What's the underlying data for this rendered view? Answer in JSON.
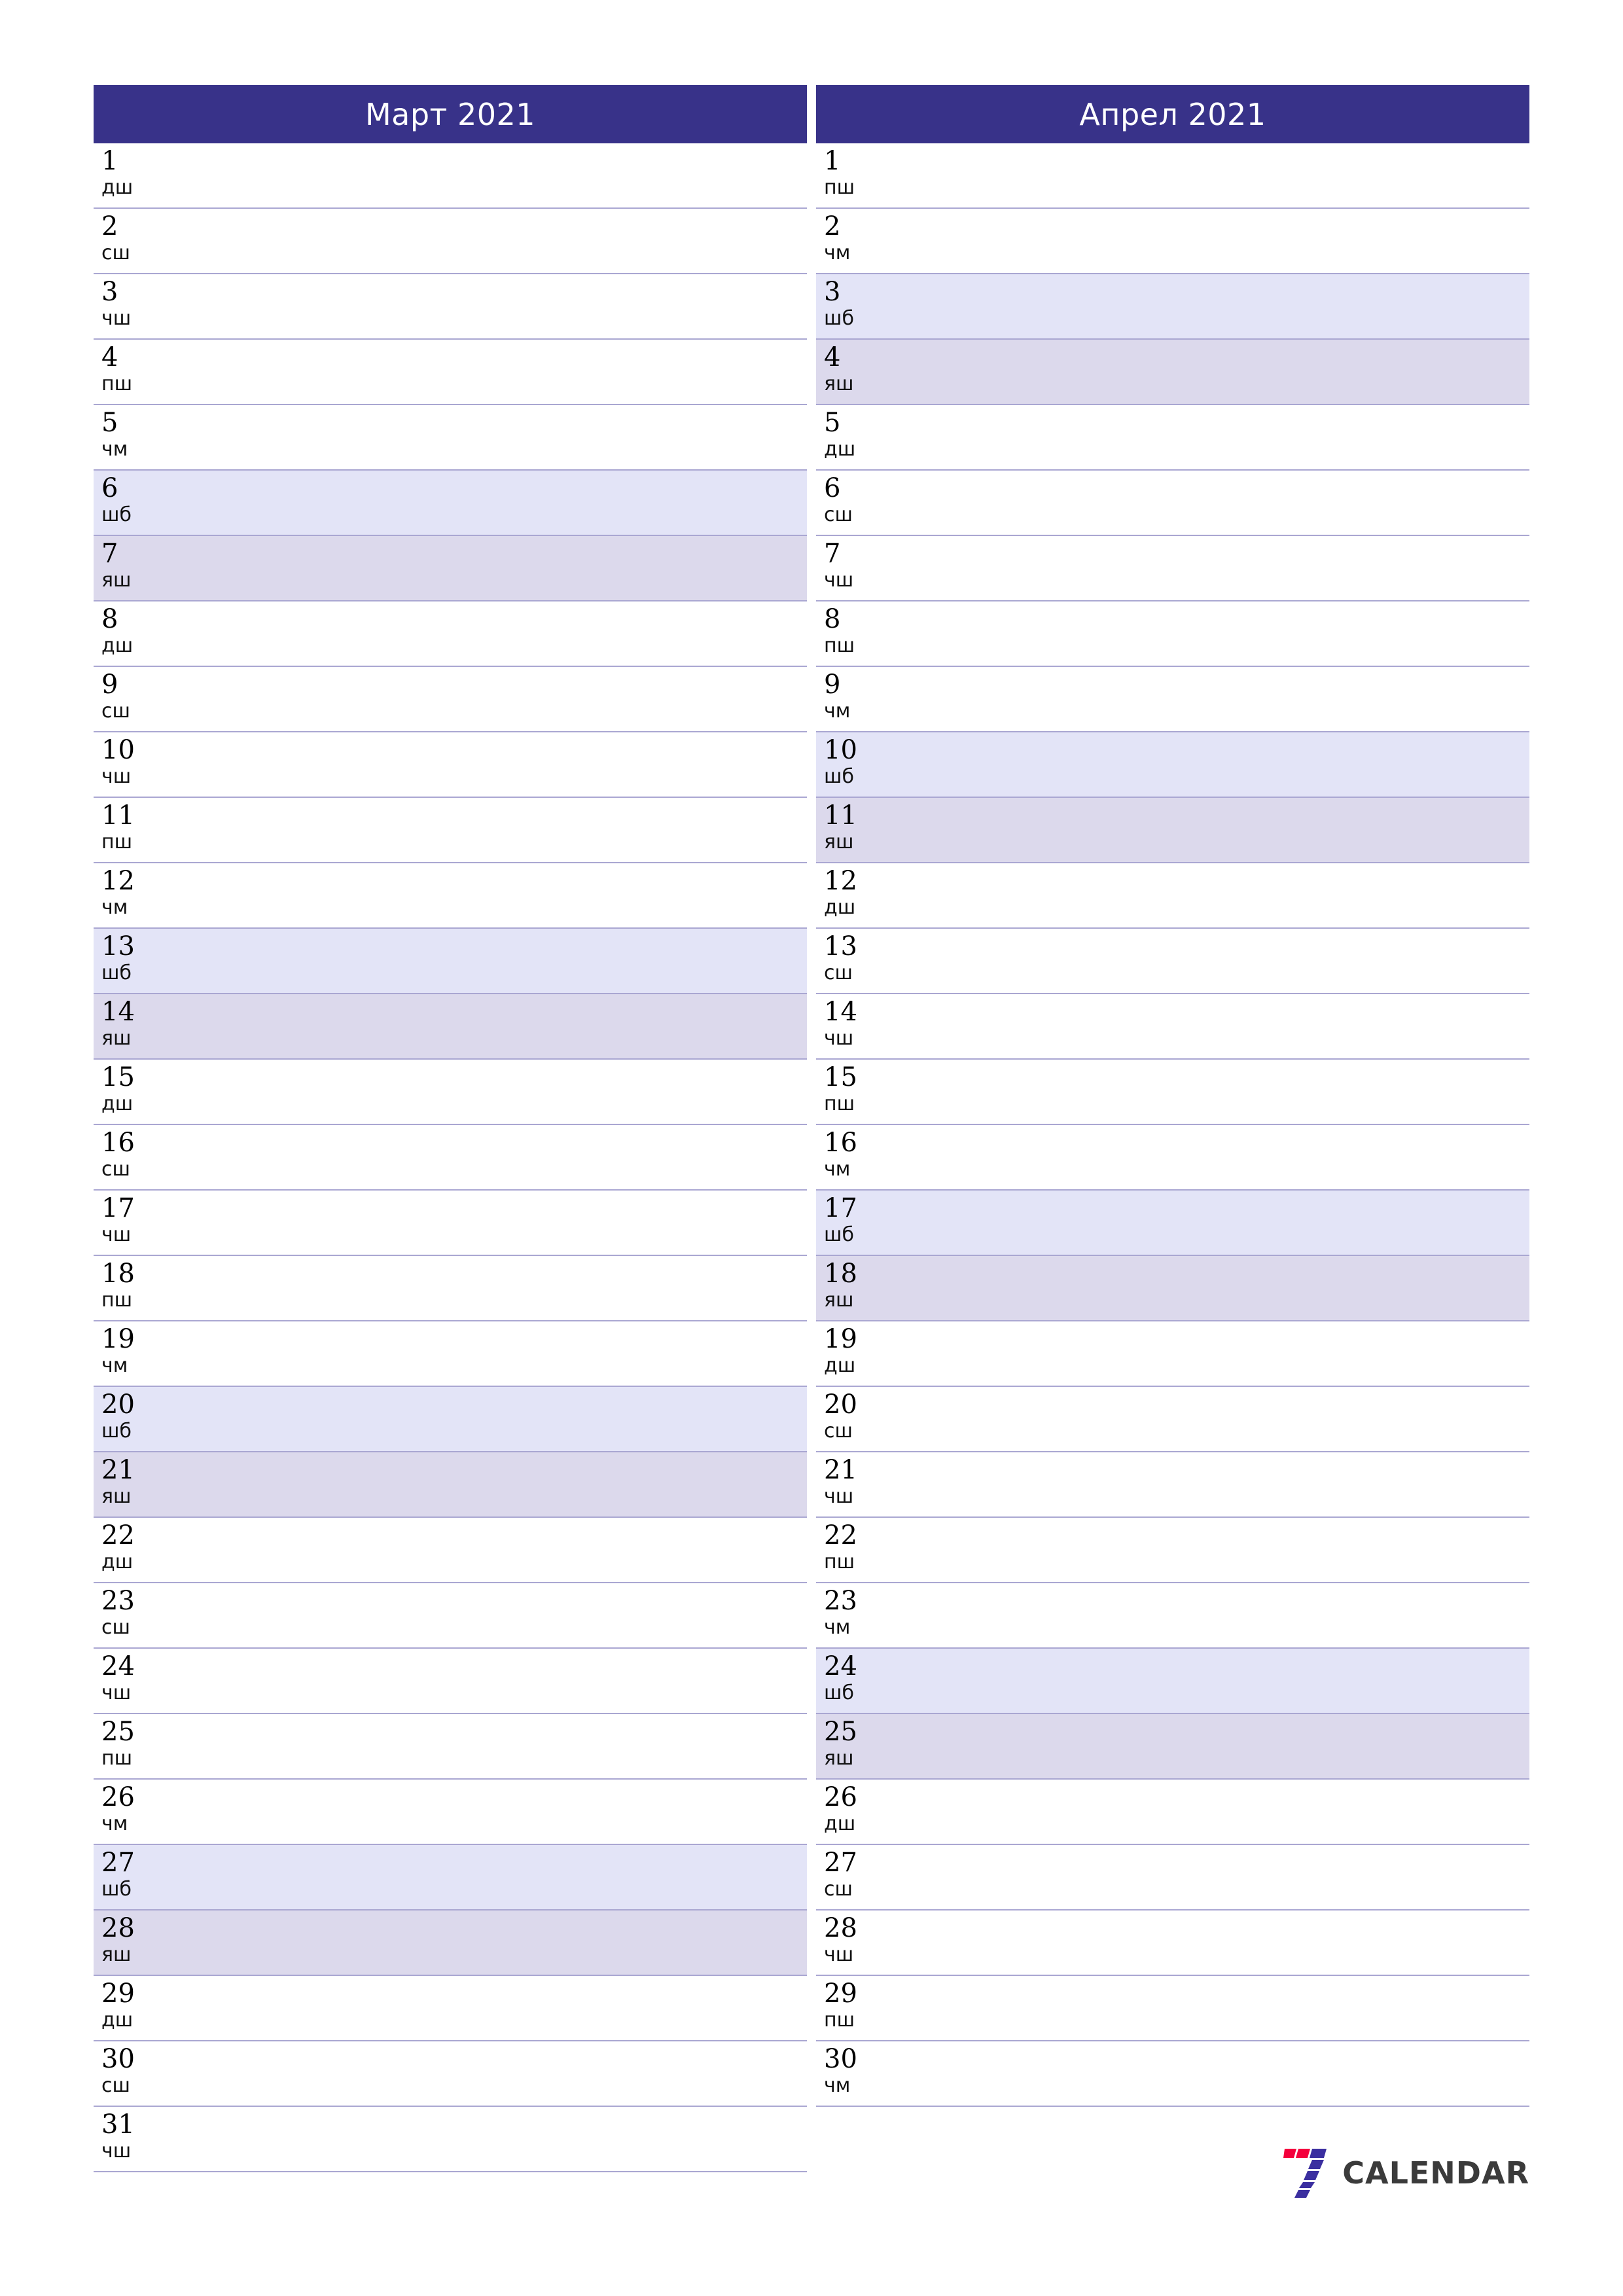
{
  "page": {
    "background": "#ffffff",
    "accent_header_color": "#383289",
    "rule_color": "#aaa7d2",
    "saturday_color": "#e3e4f7",
    "sunday_color": "#dcd9ec"
  },
  "logo": {
    "name": "7-calendar-logo",
    "text": "CALENDAR",
    "mark_red": "#f4003c",
    "mark_purple": "#3b2fa0"
  },
  "months": [
    {
      "title": "Март 2021",
      "days": [
        {
          "num": "1",
          "wd": "дш",
          "type": "weekday"
        },
        {
          "num": "2",
          "wd": "сш",
          "type": "weekday"
        },
        {
          "num": "3",
          "wd": "чш",
          "type": "weekday"
        },
        {
          "num": "4",
          "wd": "пш",
          "type": "weekday"
        },
        {
          "num": "5",
          "wd": "чм",
          "type": "weekday"
        },
        {
          "num": "6",
          "wd": "шб",
          "type": "sat"
        },
        {
          "num": "7",
          "wd": "яш",
          "type": "sun"
        },
        {
          "num": "8",
          "wd": "дш",
          "type": "weekday"
        },
        {
          "num": "9",
          "wd": "сш",
          "type": "weekday"
        },
        {
          "num": "10",
          "wd": "чш",
          "type": "weekday"
        },
        {
          "num": "11",
          "wd": "пш",
          "type": "weekday"
        },
        {
          "num": "12",
          "wd": "чм",
          "type": "weekday"
        },
        {
          "num": "13",
          "wd": "шб",
          "type": "sat"
        },
        {
          "num": "14",
          "wd": "яш",
          "type": "sun"
        },
        {
          "num": "15",
          "wd": "дш",
          "type": "weekday"
        },
        {
          "num": "16",
          "wd": "сш",
          "type": "weekday"
        },
        {
          "num": "17",
          "wd": "чш",
          "type": "weekday"
        },
        {
          "num": "18",
          "wd": "пш",
          "type": "weekday"
        },
        {
          "num": "19",
          "wd": "чм",
          "type": "weekday"
        },
        {
          "num": "20",
          "wd": "шб",
          "type": "sat"
        },
        {
          "num": "21",
          "wd": "яш",
          "type": "sun"
        },
        {
          "num": "22",
          "wd": "дш",
          "type": "weekday"
        },
        {
          "num": "23",
          "wd": "сш",
          "type": "weekday"
        },
        {
          "num": "24",
          "wd": "чш",
          "type": "weekday"
        },
        {
          "num": "25",
          "wd": "пш",
          "type": "weekday"
        },
        {
          "num": "26",
          "wd": "чм",
          "type": "weekday"
        },
        {
          "num": "27",
          "wd": "шб",
          "type": "sat"
        },
        {
          "num": "28",
          "wd": "яш",
          "type": "sun"
        },
        {
          "num": "29",
          "wd": "дш",
          "type": "weekday"
        },
        {
          "num": "30",
          "wd": "сш",
          "type": "weekday"
        },
        {
          "num": "31",
          "wd": "чш",
          "type": "weekday"
        }
      ]
    },
    {
      "title": "Апрел 2021",
      "days": [
        {
          "num": "1",
          "wd": "пш",
          "type": "weekday"
        },
        {
          "num": "2",
          "wd": "чм",
          "type": "weekday"
        },
        {
          "num": "3",
          "wd": "шб",
          "type": "sat"
        },
        {
          "num": "4",
          "wd": "яш",
          "type": "sun"
        },
        {
          "num": "5",
          "wd": "дш",
          "type": "weekday"
        },
        {
          "num": "6",
          "wd": "сш",
          "type": "weekday"
        },
        {
          "num": "7",
          "wd": "чш",
          "type": "weekday"
        },
        {
          "num": "8",
          "wd": "пш",
          "type": "weekday"
        },
        {
          "num": "9",
          "wd": "чм",
          "type": "weekday"
        },
        {
          "num": "10",
          "wd": "шб",
          "type": "sat"
        },
        {
          "num": "11",
          "wd": "яш",
          "type": "sun"
        },
        {
          "num": "12",
          "wd": "дш",
          "type": "weekday"
        },
        {
          "num": "13",
          "wd": "сш",
          "type": "weekday"
        },
        {
          "num": "14",
          "wd": "чш",
          "type": "weekday"
        },
        {
          "num": "15",
          "wd": "пш",
          "type": "weekday"
        },
        {
          "num": "16",
          "wd": "чм",
          "type": "weekday"
        },
        {
          "num": "17",
          "wd": "шб",
          "type": "sat"
        },
        {
          "num": "18",
          "wd": "яш",
          "type": "sun"
        },
        {
          "num": "19",
          "wd": "дш",
          "type": "weekday"
        },
        {
          "num": "20",
          "wd": "сш",
          "type": "weekday"
        },
        {
          "num": "21",
          "wd": "чш",
          "type": "weekday"
        },
        {
          "num": "22",
          "wd": "пш",
          "type": "weekday"
        },
        {
          "num": "23",
          "wd": "чм",
          "type": "weekday"
        },
        {
          "num": "24",
          "wd": "шб",
          "type": "sat"
        },
        {
          "num": "25",
          "wd": "яш",
          "type": "sun"
        },
        {
          "num": "26",
          "wd": "дш",
          "type": "weekday"
        },
        {
          "num": "27",
          "wd": "сш",
          "type": "weekday"
        },
        {
          "num": "28",
          "wd": "чш",
          "type": "weekday"
        },
        {
          "num": "29",
          "wd": "пш",
          "type": "weekday"
        },
        {
          "num": "30",
          "wd": "чм",
          "type": "weekday"
        }
      ]
    }
  ]
}
